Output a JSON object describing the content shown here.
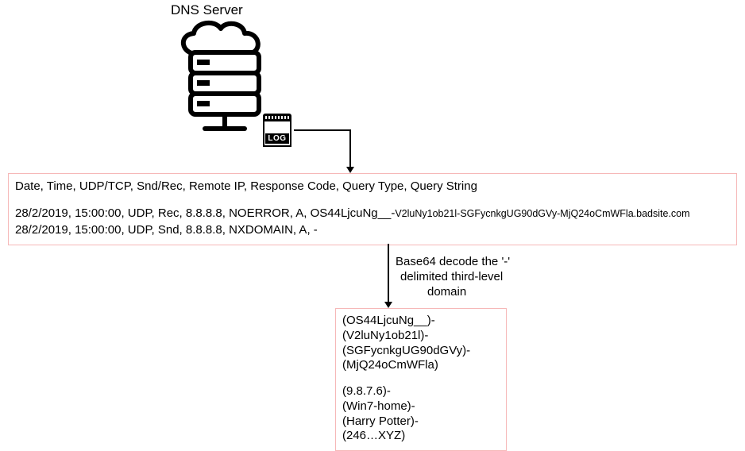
{
  "title": "DNS Server",
  "log_icon_label": "LOG",
  "log_table": {
    "header": "Date, Time, UDP/TCP, Snd/Rec, Remote IP, Response Code, Query Type, Query String",
    "row1_prefix": "28/2/2019, 15:00:00, UDP, Rec, 8.8.8.8, NOERROR, A, OS44LjcuNg__-",
    "row1_small": "V2luNy1ob21l-SGFycnkgUG90dGVy-MjQ24oCmWFla.badsite.com",
    "row2": "28/2/2019, 15:00:00, UDP, Snd, 8.8.8.8, NXDOMAIN, A, -"
  },
  "arrow2_label_line1": "Base64 decode the '-'",
  "arrow2_label_line2": "delimited third-level",
  "arrow2_label_line3": "domain",
  "decode": {
    "e1": "(OS44LjcuNg__)-",
    "e2": "(V2luNy1ob21l)-",
    "e3": "(SGFycnkgUG90dGVy)-",
    "e4": "(MjQ24oCmWFla)",
    "d1": "(9.8.7.6)-",
    "d2": "(Win7-home)-",
    "d3": "(Harry Potter)-",
    "d4": "(246…XYZ)"
  }
}
